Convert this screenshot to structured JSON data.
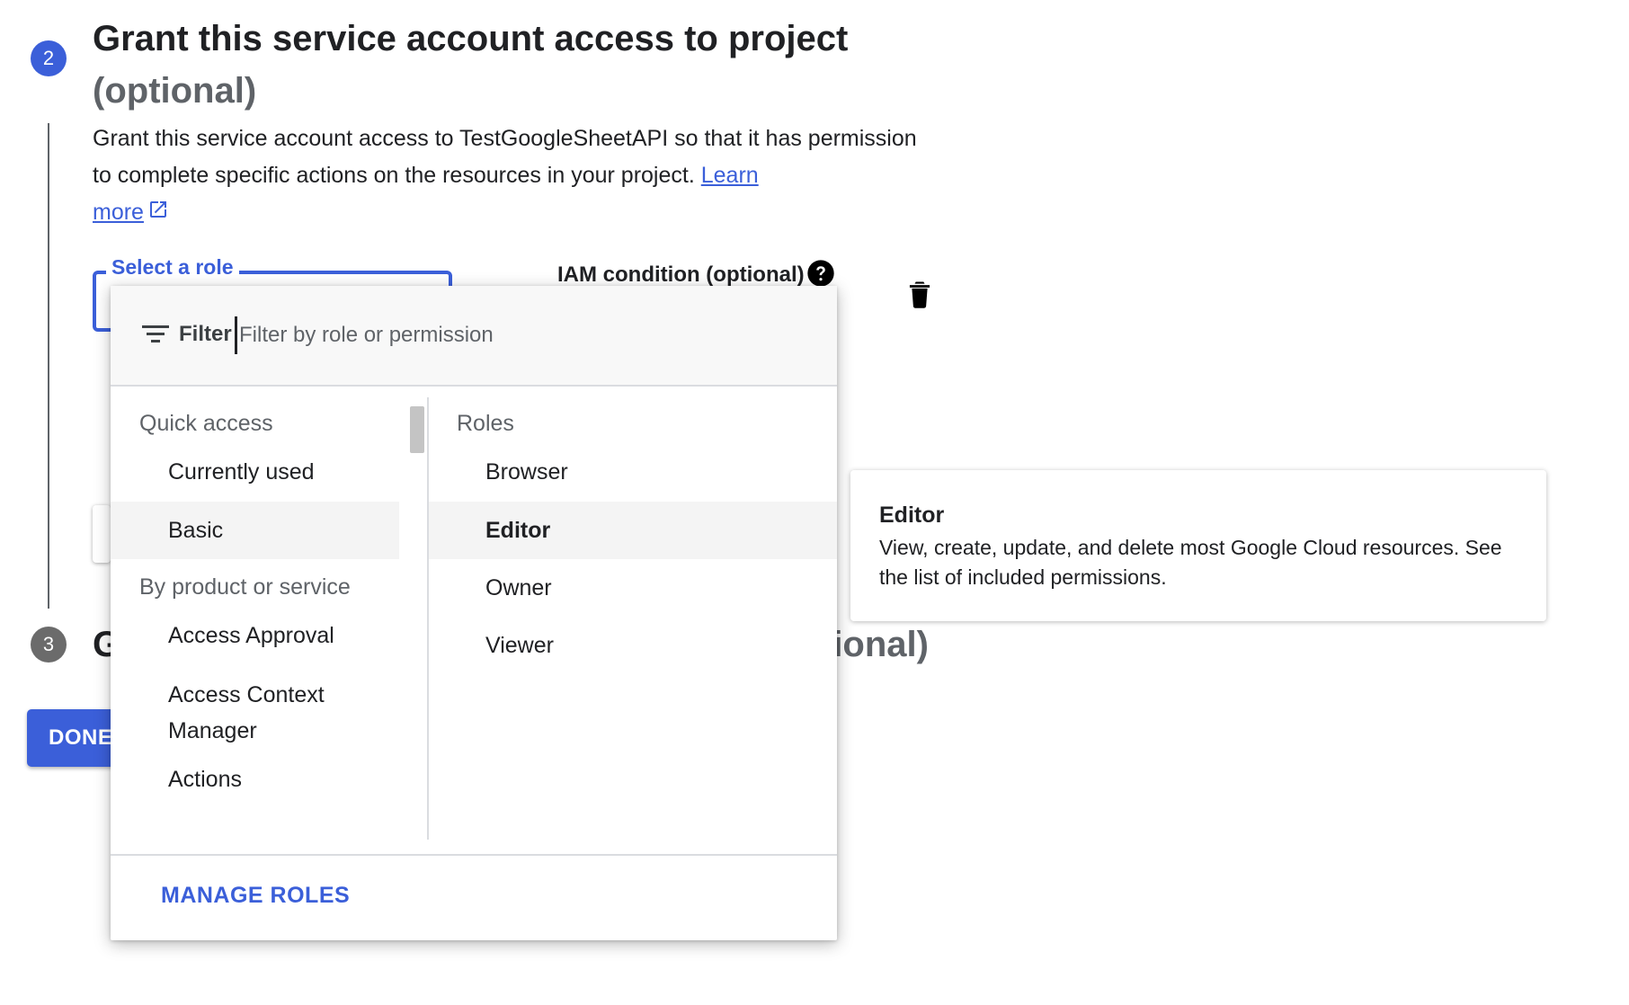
{
  "step2": {
    "number": "2",
    "title": "Grant this service account access to project",
    "title_optional": "(optional)",
    "description": "Grant this service account access to TestGoogleSheetAPI so that it has permission to complete specific actions on the resources in your project.",
    "learn_more_part1": "Learn",
    "learn_more_part2": "more"
  },
  "role_select": {
    "label": "Select a role"
  },
  "iam_condition": {
    "label": "IAM condition (optional)"
  },
  "step3": {
    "number": "3",
    "title_visible_start": "G",
    "title_visible_end": "tional)"
  },
  "done_button": {
    "label": "DONE"
  },
  "dropdown": {
    "filter_label": "Filter",
    "filter_placeholder": "Filter by role or permission",
    "left_column": {
      "quick_access_header": "Quick access",
      "quick_access_items": [
        "Currently used",
        "Basic"
      ],
      "by_product_header": "By product or service",
      "product_items": [
        "Access Approval",
        "Access Context Manager",
        "Actions"
      ]
    },
    "right_column": {
      "header": "Roles",
      "items": [
        "Browser",
        "Editor",
        "Owner",
        "Viewer"
      ]
    },
    "footer_button": "MANAGE ROLES"
  },
  "tooltip": {
    "title": "Editor",
    "description": "View, create, update, and delete most Google Cloud resources. See the list of included permissions."
  },
  "colors": {
    "accent": "#3b5fd9",
    "inactive_step": "#6b6b6b",
    "selected_row": "#f4f4f4"
  },
  "icons": {
    "help": "help-circle-icon",
    "delete": "trash-icon",
    "filter": "filter-list-icon",
    "external_link": "open-in-new-icon"
  }
}
